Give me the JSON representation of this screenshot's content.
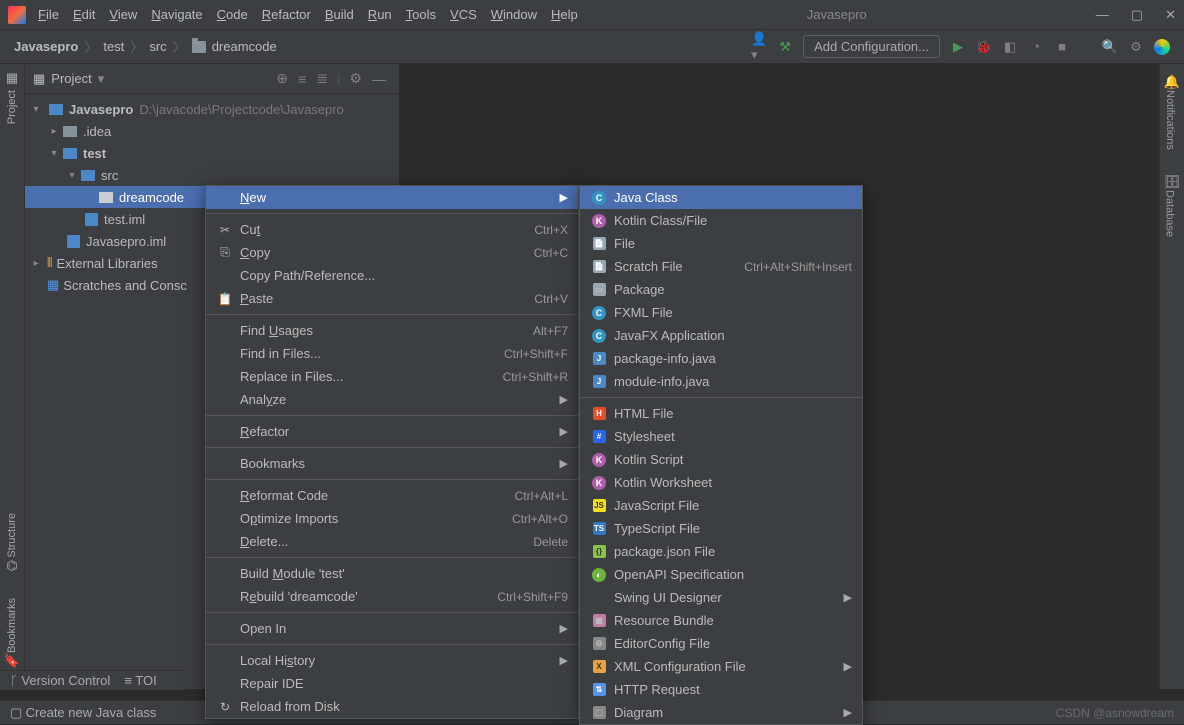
{
  "title": "Javasepro",
  "menubar": [
    "File",
    "Edit",
    "View",
    "Navigate",
    "Code",
    "Refactor",
    "Build",
    "Run",
    "Tools",
    "VCS",
    "Window",
    "Help"
  ],
  "breadcrumb": [
    "Javasepro",
    "test",
    "src",
    "dreamcode"
  ],
  "add_config": "Add Configuration...",
  "project_label": "Project",
  "tree": {
    "root": {
      "name": "Javasepro",
      "path": "D:\\javacode\\Projectcode\\Javasepro"
    },
    "idea": ".idea",
    "test": "test",
    "src": "src",
    "dreamcode": "dreamcode",
    "testiml": "test.iml",
    "projiml": "Javasepro.iml",
    "extlib": "External Libraries",
    "scratch": "Scratches and Consc"
  },
  "ctx1": [
    {
      "t": "row",
      "label": "New",
      "hl": true,
      "sub": true,
      "u": 0
    },
    {
      "t": "sep"
    },
    {
      "t": "row",
      "icon": "✂",
      "label": "Cut",
      "sc": "Ctrl+X",
      "u": 2
    },
    {
      "t": "row",
      "icon": "⎘",
      "label": "Copy",
      "sc": "Ctrl+C",
      "u": 0
    },
    {
      "t": "row",
      "label": "Copy Path/Reference..."
    },
    {
      "t": "row",
      "icon": "📋",
      "label": "Paste",
      "sc": "Ctrl+V",
      "u": 0
    },
    {
      "t": "sep"
    },
    {
      "t": "row",
      "label": "Find Usages",
      "sc": "Alt+F7",
      "u": 5
    },
    {
      "t": "row",
      "label": "Find in Files...",
      "sc": "Ctrl+Shift+F"
    },
    {
      "t": "row",
      "label": "Replace in Files...",
      "sc": "Ctrl+Shift+R"
    },
    {
      "t": "row",
      "label": "Analyze",
      "sub": true,
      "u": 4
    },
    {
      "t": "sep"
    },
    {
      "t": "row",
      "label": "Refactor",
      "sub": true,
      "u": 0
    },
    {
      "t": "sep"
    },
    {
      "t": "row",
      "label": "Bookmarks",
      "sub": true
    },
    {
      "t": "sep"
    },
    {
      "t": "row",
      "label": "Reformat Code",
      "sc": "Ctrl+Alt+L",
      "u": 0
    },
    {
      "t": "row",
      "label": "Optimize Imports",
      "sc": "Ctrl+Alt+O",
      "u": 1
    },
    {
      "t": "row",
      "label": "Delete...",
      "sc": "Delete",
      "u": 0
    },
    {
      "t": "sep"
    },
    {
      "t": "row",
      "label": "Build Module 'test'",
      "u": 6
    },
    {
      "t": "row",
      "label": "Rebuild 'dreamcode'",
      "sc": "Ctrl+Shift+F9",
      "u": 1
    },
    {
      "t": "sep"
    },
    {
      "t": "row",
      "label": "Open In",
      "sub": true
    },
    {
      "t": "sep"
    },
    {
      "t": "row",
      "label": "Local History",
      "sub": true,
      "u": 8
    },
    {
      "t": "row",
      "label": "Repair IDE"
    },
    {
      "t": "row",
      "icon": "↻",
      "label": "Reload from Disk"
    }
  ],
  "ctx2": [
    {
      "t": "row",
      "ic": "c",
      "label": "Java Class",
      "hl": true
    },
    {
      "t": "row",
      "ic": "k",
      "label": "Kotlin Class/File"
    },
    {
      "t": "row",
      "ic": "f",
      "label": "File"
    },
    {
      "t": "row",
      "ic": "f",
      "label": "Scratch File",
      "sc": "Ctrl+Alt+Shift+Insert"
    },
    {
      "t": "row",
      "ic": "p",
      "label": "Package"
    },
    {
      "t": "row",
      "ic": "c",
      "label": "FXML File"
    },
    {
      "t": "row",
      "ic": "c",
      "label": "JavaFX Application"
    },
    {
      "t": "row",
      "ic": "j",
      "label": "package-info.java"
    },
    {
      "t": "row",
      "ic": "j",
      "label": "module-info.java"
    },
    {
      "t": "sep"
    },
    {
      "t": "row",
      "ic": "h",
      "label": "HTML File"
    },
    {
      "t": "row",
      "ic": "css",
      "label": "Stylesheet"
    },
    {
      "t": "row",
      "ic": "k",
      "label": "Kotlin Script"
    },
    {
      "t": "row",
      "ic": "k",
      "label": "Kotlin Worksheet"
    },
    {
      "t": "row",
      "ic": "js",
      "label": "JavaScript File"
    },
    {
      "t": "row",
      "ic": "ts",
      "label": "TypeScript File"
    },
    {
      "t": "row",
      "ic": "pj",
      "label": "package.json File"
    },
    {
      "t": "row",
      "ic": "o",
      "label": "OpenAPI Specification"
    },
    {
      "t": "row",
      "label": "Swing UI Designer",
      "sub": true
    },
    {
      "t": "row",
      "ic": "rb",
      "label": "Resource Bundle"
    },
    {
      "t": "row",
      "ic": "ec",
      "label": "EditorConfig File"
    },
    {
      "t": "row",
      "ic": "x",
      "label": "XML Configuration File",
      "sub": true
    },
    {
      "t": "row",
      "ic": "ht",
      "label": "HTTP Request"
    },
    {
      "t": "row",
      "ic": "d",
      "label": "Diagram",
      "sub": true
    }
  ],
  "left_tools": [
    "Project",
    "Structure",
    "Bookmarks"
  ],
  "right_tools": [
    "Notifications",
    "Database"
  ],
  "bottom_tools": [
    "Version Control",
    "TOI"
  ],
  "status": "Create new Java class",
  "watermark": "CSDN @asnowdream"
}
